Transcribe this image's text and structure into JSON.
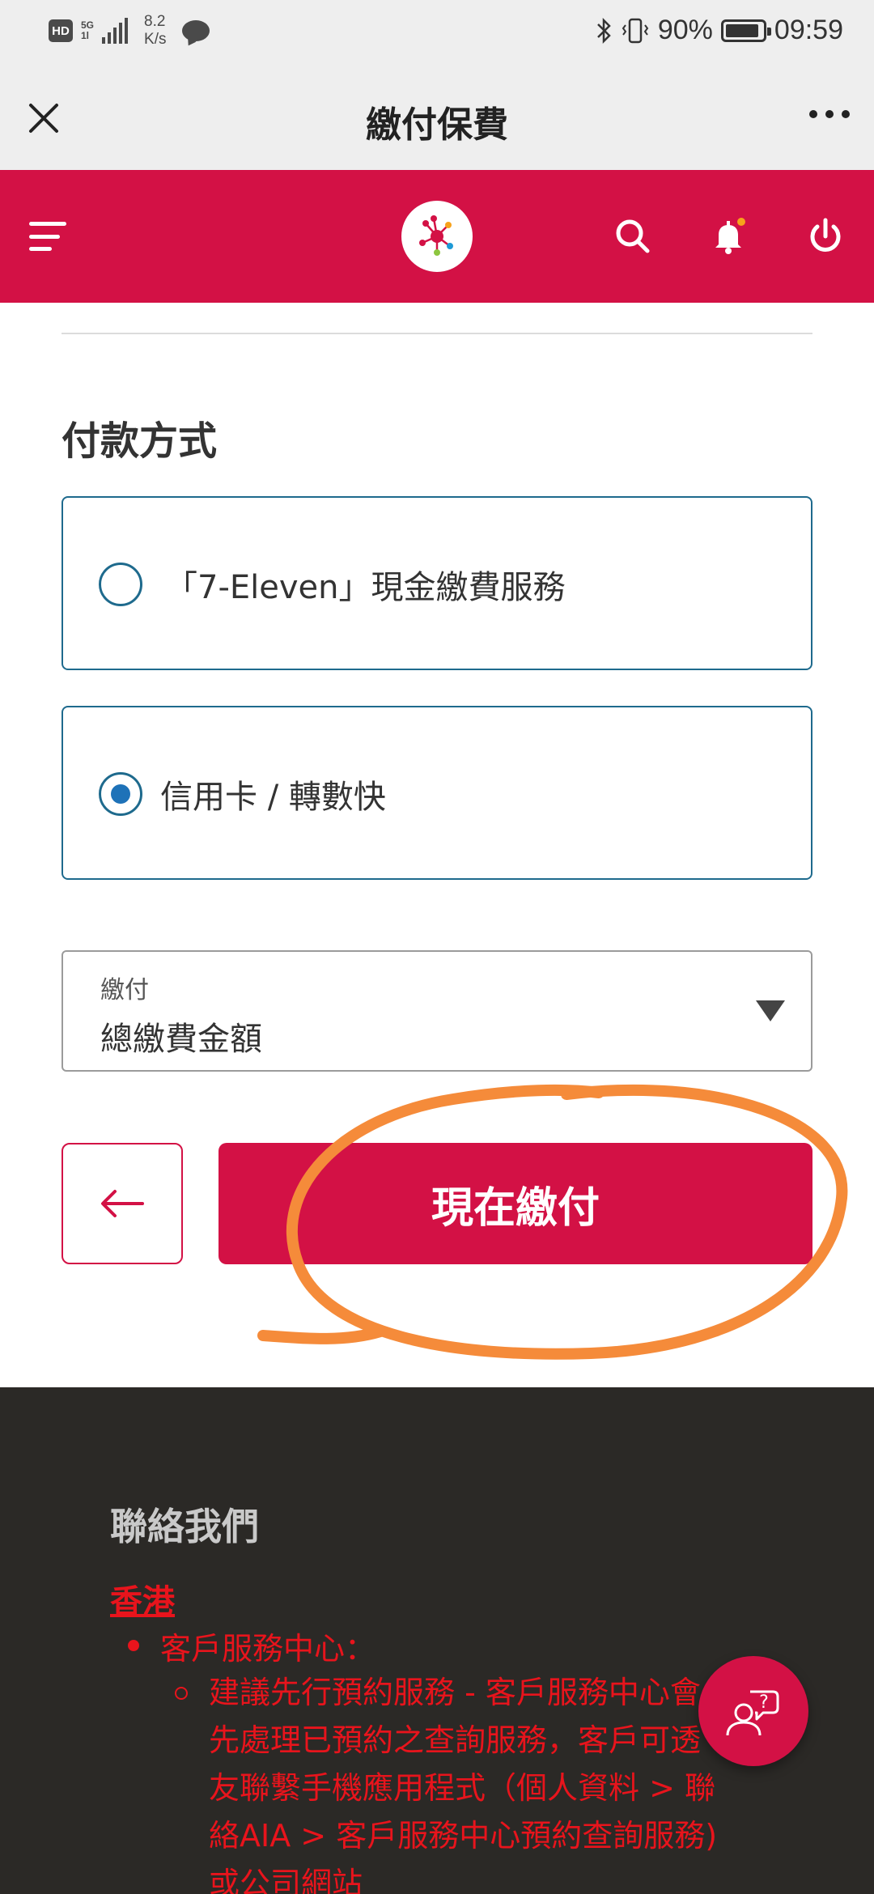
{
  "status_bar": {
    "hd": "HD",
    "network": "5G",
    "network_sub": "1l",
    "speed_value": "8.2",
    "speed_unit": "K/s",
    "battery": "90%",
    "battery_level": 0.9,
    "time": "09:59"
  },
  "title_bar": {
    "title": "繳付保費"
  },
  "header": {
    "brand_color": "#d31145"
  },
  "payment": {
    "section_title": "付款方式",
    "options": [
      {
        "label": "「7-Eleven」現金繳費服務",
        "selected": false
      },
      {
        "label": "信用卡 / 轉數快",
        "selected": true
      }
    ],
    "amount_select": {
      "caption": "繳付",
      "value": "總繳費金額"
    },
    "pay_button": "現在繳付"
  },
  "footer": {
    "title": "聯絡我們",
    "region": "香港",
    "bullet": "客戶服務中心：",
    "sub_lines": [
      "建議先行預約服務 - 客戶服務中心會",
      "先處理已預約之查詢服務，客戶可透",
      "友聯繫手機應用程式（個人資料 > 聯",
      "絡AIA > 客戶服務中心預約查詢服務)",
      "或公司網站"
    ]
  },
  "colors": {
    "accent": "#d31145",
    "radio": "#1e6a8d",
    "footer_bg": "#2b2926",
    "footer_text": "#e8141c",
    "annotation": "#f58b3a"
  }
}
